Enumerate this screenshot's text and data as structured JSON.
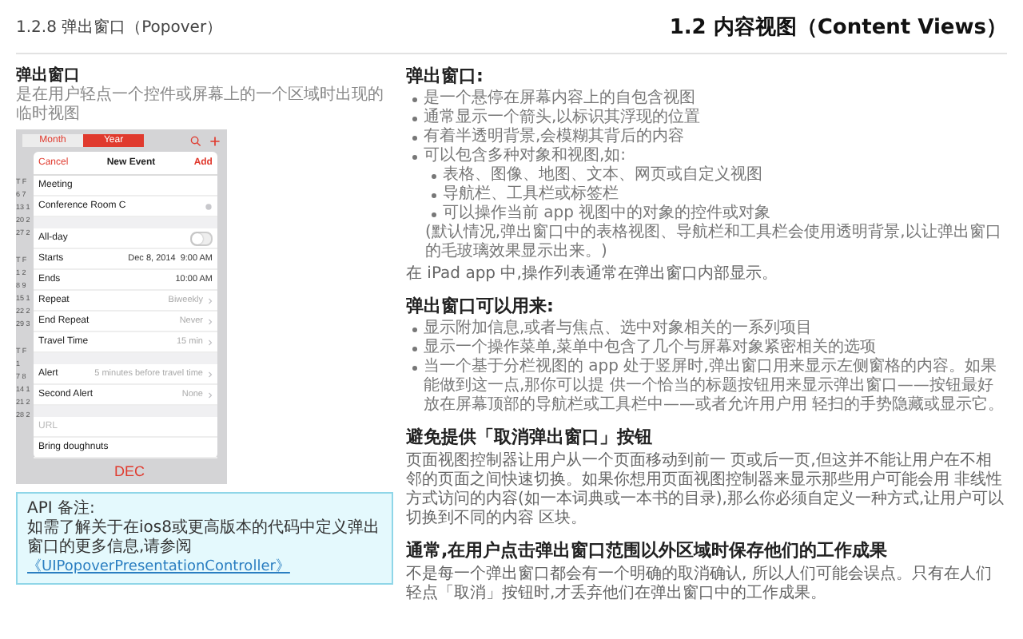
{
  "header": {
    "section": "1.2.8  弹出窗口（Popover）",
    "chapter": "1.2   内容视图（Content Views）"
  },
  "left": {
    "title": "弹出窗口",
    "subtitle": "是在用户轻点一个控件或屏幕上的一个区域时出现的临时视图",
    "phone": {
      "tabs": [
        {
          "label": "Month",
          "selected": false
        },
        {
          "label": "Year",
          "selected": true
        }
      ],
      "calendar": [
        [
          "T F",
          "6 7",
          "13 1",
          "20 2",
          "27 2"
        ],
        [
          "T F",
          "1 2",
          "8 9",
          "15 1",
          "22 2",
          "29 3"
        ],
        [
          "T F",
          "1",
          "7 8",
          "14 1",
          "21 2",
          "28 2"
        ]
      ],
      "popover": {
        "cancel": "Cancel",
        "title": "New Event",
        "add": "Add",
        "groups": [
          [
            {
              "kind": "text",
              "label": "Meeting"
            },
            {
              "kind": "location",
              "label": "Conference Room C"
            }
          ],
          [
            {
              "kind": "toggle",
              "label": "All-day",
              "on": false
            },
            {
              "kind": "dual",
              "label": "Starts",
              "value": "Dec 8, 2014",
              "value_2": "9:00 AM"
            },
            {
              "kind": "plain",
              "label": "Ends",
              "value": "10:00 AM"
            },
            {
              "kind": "detail",
              "label": "Repeat",
              "value": "Biweekly"
            },
            {
              "kind": "detail",
              "label": "End Repeat",
              "value": "Never"
            },
            {
              "kind": "detail",
              "label": "Travel Time",
              "value": "15 min"
            }
          ],
          [
            {
              "kind": "detail",
              "label": "Alert",
              "value": "5 minutes before travel time"
            },
            {
              "kind": "detail",
              "label": "Second Alert",
              "value": "None"
            }
          ],
          [
            {
              "kind": "field",
              "placeholder": "URL"
            },
            {
              "kind": "text",
              "label": "Bring doughnuts"
            }
          ]
        ]
      },
      "month": "DEC"
    },
    "api_note": {
      "label": "API 备注:",
      "text": "如需了解关于在ios8或更高版本的代码中定义弹出窗口的更多信息,请参阅",
      "link": "《UIPopoverPresentationController》"
    }
  },
  "sections": [
    {
      "heading": "弹出窗口:",
      "items": [
        {
          "kind": "bullet",
          "text": "是一个悬停在屏幕内容上的自包含视图"
        },
        {
          "kind": "bullet",
          "text": "通常显示一个箭头,以标识其浮现的位置"
        },
        {
          "kind": "bullet",
          "text": "有着半透明背景,会模糊其背后的内容"
        },
        {
          "kind": "bullet",
          "text": "可以包含多种对象和视图,如:",
          "children": [
            {
              "kind": "bullet",
              "text": "表格、图像、地图、文本、网页或自定义视图"
            },
            {
              "kind": "bullet",
              "text": "导航栏、工具栏或标签栏"
            },
            {
              "kind": "bullet",
              "text": "可以操作当前 app 视图中的对象的控件或对象"
            },
            {
              "kind": "note",
              "text": "(默认情况,弹出窗口中的表格视图、导航栏和工具栏会使用透明背景,以让弹出窗口的毛玻璃效果显示出来。)"
            }
          ]
        },
        {
          "kind": "paragraph",
          "text": "在 iPad app 中,操作列表通常在弹出窗口内部显示。"
        }
      ]
    },
    {
      "heading": "弹出窗口可以用来:",
      "items": [
        {
          "kind": "bullet",
          "text": "显示附加信息,或者与焦点、选中对象相关的一系列项目"
        },
        {
          "kind": "bullet",
          "text": "显示一个操作菜单,菜单中包含了几个与屏幕对象紧密相关的选项"
        },
        {
          "kind": "bullet",
          "text": "当一个基于分栏视图的 app 处于竖屏时,弹出窗口用来显示左侧窗格的内容。如果能做到这一点,那你可以提 供一个恰当的标题按钮用来显示弹出窗口——按钮最好放在屏幕顶部的导航栏或工具栏中——或者允许用户用 轻扫的手势隐藏或显示它。"
        }
      ]
    },
    {
      "heading": "避免提供「取消弹出窗口」按钮",
      "items": [
        {
          "kind": "paragraph",
          "text": "页面视图控制器让用户从一个页面移动到前一 页或后一页,但这并不能让用户在不相邻的页面之间快速切换。如果你想用页面视图控制器来显示那些用户可能会用 非线性方式访问的内容(如一本词典或一本书的目录),那么你必须自定义一种方式,让用户可以切换到不同的内容 区块。"
        }
      ]
    },
    {
      "heading": "通常,在用户点击弹出窗口范围以外区域时保存他们的工作成果",
      "items": [
        {
          "kind": "paragraph",
          "text": "不是每一个弹出窗口都会有一个明确的取消确认, 所以人们可能会误点。只有在人们轻点「取消」按钮时,才丢弃他们在弹出窗口中的工作成果。"
        }
      ]
    }
  ]
}
